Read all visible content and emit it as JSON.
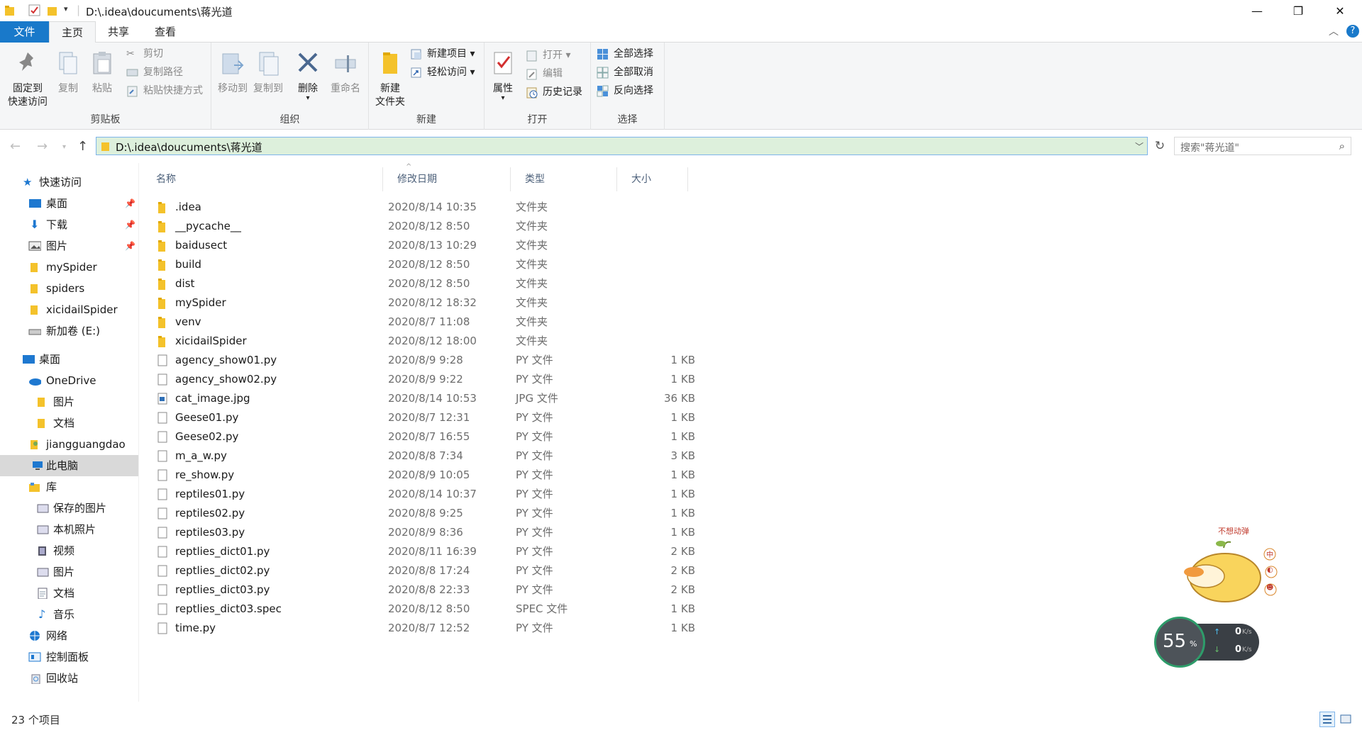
{
  "window": {
    "title": "D:\\.idea\\doucuments\\蒋光道",
    "minimize": "—",
    "maximize": "❐",
    "close": "✕"
  },
  "tabs": {
    "file": "文件",
    "home": "主页",
    "share": "共享",
    "view": "查看"
  },
  "ribbon": {
    "clipboard": {
      "label": "剪贴板",
      "pin": "固定到\n快速访问",
      "pin_l1": "固定到",
      "pin_l2": "快速访问",
      "copy": "复制",
      "paste": "粘贴",
      "cut": "剪切",
      "copy_path": "复制路径",
      "paste_shortcut": "粘贴快捷方式"
    },
    "organize": {
      "label": "组织",
      "move_to": "移动到",
      "copy_to": "复制到",
      "delete": "删除",
      "rename": "重命名"
    },
    "new": {
      "label": "新建",
      "new_folder_l1": "新建",
      "new_folder_l2": "文件夹",
      "new_item": "新建项目 ▾",
      "easy_access": "轻松访问 ▾"
    },
    "open": {
      "label": "打开",
      "properties": "属性",
      "open": "打开 ▾",
      "edit": "编辑",
      "history": "历史记录"
    },
    "select": {
      "label": "选择",
      "select_all": "全部选择",
      "select_none": "全部取消",
      "invert": "反向选择"
    }
  },
  "address": {
    "path": "D:\\.idea\\doucuments\\蒋光道",
    "search_placeholder": "搜索\"蒋光道\""
  },
  "nav": {
    "quick_access": "快速访问",
    "items": [
      {
        "label": "桌面",
        "pinned": true
      },
      {
        "label": "下载",
        "pinned": true
      },
      {
        "label": "图片",
        "pinned": true
      },
      {
        "label": "mySpider",
        "pinned": false
      },
      {
        "label": "spiders",
        "pinned": false
      },
      {
        "label": "xicidailSpider",
        "pinned": false
      },
      {
        "label": "新加卷 (E:)",
        "pinned": false
      }
    ],
    "desktop": "桌面",
    "onedrive": "OneDrive",
    "onedrive_pictures": "图片",
    "onedrive_docs": "文档",
    "user": "jiangguangdao",
    "this_pc": "此电脑",
    "library": "库",
    "lib_saved_pictures": "保存的图片",
    "lib_camera_roll": "本机照片",
    "lib_videos": "视频",
    "lib_pictures": "图片",
    "lib_docs": "文档",
    "lib_music": "音乐",
    "network": "网络",
    "control_panel": "控制面板",
    "recycle_bin": "回收站"
  },
  "columns": {
    "name": "名称",
    "date": "修改日期",
    "type": "类型",
    "size": "大小"
  },
  "files": [
    {
      "name": ".idea",
      "date": "2020/8/14 10:35",
      "type": "文件夹",
      "size": "",
      "kind": "folder"
    },
    {
      "name": "__pycache__",
      "date": "2020/8/12 8:50",
      "type": "文件夹",
      "size": "",
      "kind": "folder"
    },
    {
      "name": "baidusect",
      "date": "2020/8/13 10:29",
      "type": "文件夹",
      "size": "",
      "kind": "folder"
    },
    {
      "name": "build",
      "date": "2020/8/12 8:50",
      "type": "文件夹",
      "size": "",
      "kind": "folder"
    },
    {
      "name": "dist",
      "date": "2020/8/12 8:50",
      "type": "文件夹",
      "size": "",
      "kind": "folder"
    },
    {
      "name": "mySpider",
      "date": "2020/8/12 18:32",
      "type": "文件夹",
      "size": "",
      "kind": "folder"
    },
    {
      "name": "venv",
      "date": "2020/8/7 11:08",
      "type": "文件夹",
      "size": "",
      "kind": "folder"
    },
    {
      "name": "xicidailSpider",
      "date": "2020/8/12 18:00",
      "type": "文件夹",
      "size": "",
      "kind": "folder"
    },
    {
      "name": "agency_show01.py",
      "date": "2020/8/9 9:28",
      "type": "PY 文件",
      "size": "1 KB",
      "kind": "file"
    },
    {
      "name": "agency_show02.py",
      "date": "2020/8/9 9:22",
      "type": "PY 文件",
      "size": "1 KB",
      "kind": "file"
    },
    {
      "name": "cat_image.jpg",
      "date": "2020/8/14 10:53",
      "type": "JPG 文件",
      "size": "36 KB",
      "kind": "image"
    },
    {
      "name": "Geese01.py",
      "date": "2020/8/7 12:31",
      "type": "PY 文件",
      "size": "1 KB",
      "kind": "file"
    },
    {
      "name": "Geese02.py",
      "date": "2020/8/7 16:55",
      "type": "PY 文件",
      "size": "1 KB",
      "kind": "file"
    },
    {
      "name": "m_a_w.py",
      "date": "2020/8/8 7:34",
      "type": "PY 文件",
      "size": "3 KB",
      "kind": "file"
    },
    {
      "name": "re_show.py",
      "date": "2020/8/9 10:05",
      "type": "PY 文件",
      "size": "1 KB",
      "kind": "file"
    },
    {
      "name": "reptiles01.py",
      "date": "2020/8/14 10:37",
      "type": "PY 文件",
      "size": "1 KB",
      "kind": "file"
    },
    {
      "name": "reptiles02.py",
      "date": "2020/8/8 9:25",
      "type": "PY 文件",
      "size": "1 KB",
      "kind": "file"
    },
    {
      "name": "reptiles03.py",
      "date": "2020/8/9 8:36",
      "type": "PY 文件",
      "size": "1 KB",
      "kind": "file"
    },
    {
      "name": "reptlies_dict01.py",
      "date": "2020/8/11 16:39",
      "type": "PY 文件",
      "size": "2 KB",
      "kind": "file"
    },
    {
      "name": "reptlies_dict02.py",
      "date": "2020/8/8 17:24",
      "type": "PY 文件",
      "size": "2 KB",
      "kind": "file"
    },
    {
      "name": "reptlies_dict03.py",
      "date": "2020/8/8 22:33",
      "type": "PY 文件",
      "size": "2 KB",
      "kind": "file"
    },
    {
      "name": "reptlies_dict03.spec",
      "date": "2020/8/12 8:50",
      "type": "SPEC 文件",
      "size": "1 KB",
      "kind": "file"
    },
    {
      "name": "time.py",
      "date": "2020/8/7 12:52",
      "type": "PY 文件",
      "size": "1 KB",
      "kind": "file"
    }
  ],
  "status": {
    "count": "23 个项目"
  },
  "widget": {
    "percent": "55",
    "percent_unit": "%",
    "up_speed": "0",
    "down_speed": "0",
    "speed_unit": "K/s",
    "sticker_text": "不想动弹",
    "sticker_badges": [
      "中",
      "◐",
      "☻"
    ]
  },
  "colors": {
    "accent": "#1979ca",
    "address_bg": "#ddf0dc",
    "selected_nav": "#d9d9d9",
    "folder": "#f4c22b"
  }
}
